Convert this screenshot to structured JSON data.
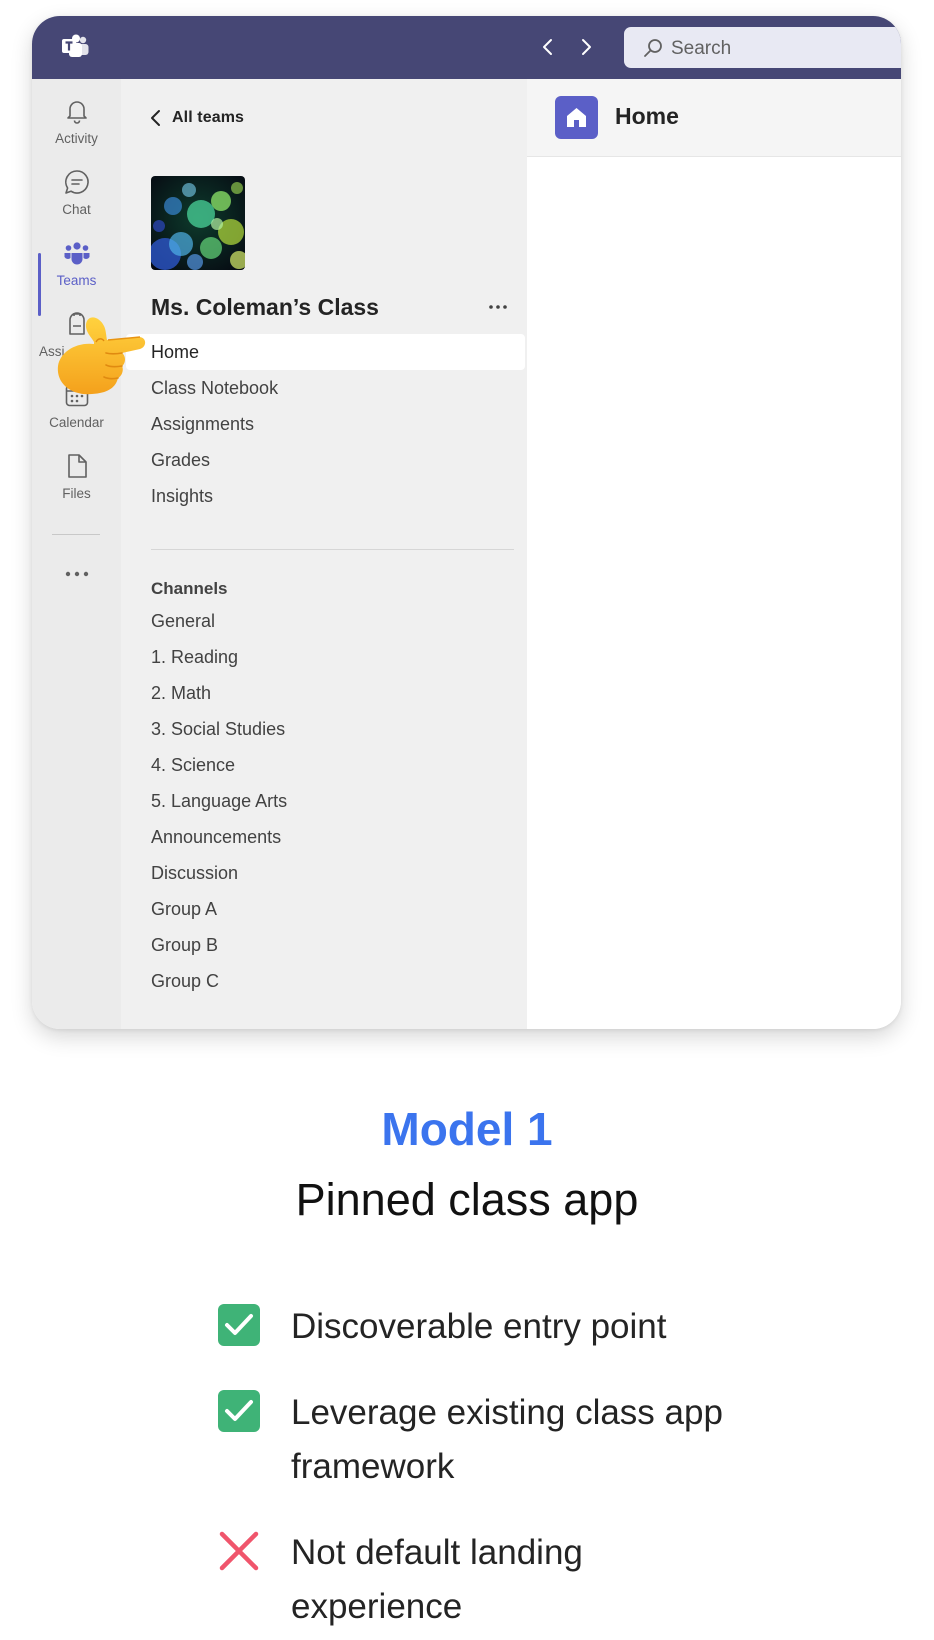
{
  "search": {
    "placeholder": "Search"
  },
  "rail": {
    "items": [
      {
        "label": "Activity",
        "icon": "bell-icon"
      },
      {
        "label": "Chat",
        "icon": "chat-icon"
      },
      {
        "label": "Teams",
        "icon": "teams-icon",
        "active": true
      },
      {
        "label": "Assignments",
        "icon": "backpack-icon",
        "visible_label": "Assi"
      },
      {
        "label": "Calendar",
        "icon": "calendar-icon"
      },
      {
        "label": "Files",
        "icon": "file-icon"
      }
    ],
    "accent": "#5b5fc7"
  },
  "team_panel": {
    "back_label": "All teams",
    "team_name": "Ms. Coleman’s Class",
    "tabs": [
      "Home",
      "Class Notebook",
      "Assignments",
      "Grades",
      "Insights"
    ],
    "selected_tab": "Home",
    "channels_header": "Channels",
    "channels": [
      "General",
      "1. Reading",
      "2. Math",
      "3. Social Studies",
      "4. Science",
      "5. Language Arts",
      "Announcements",
      "Discussion",
      "Group A",
      "Group B",
      "Group C"
    ]
  },
  "content": {
    "title": "Home"
  },
  "slide": {
    "model_title": "Model 1",
    "model_subtitle": "Pinned class app",
    "points": [
      {
        "mark": "check",
        "text": "Discoverable entry point"
      },
      {
        "mark": "check",
        "text": "Leverage existing class app framework"
      },
      {
        "mark": "cross",
        "text": "Not default landing experience"
      }
    ],
    "colors": {
      "title_blue": "#3b74ee",
      "check_green": "#3fb377",
      "cross_red": "#f0556c",
      "titlebar": "#464775"
    }
  }
}
